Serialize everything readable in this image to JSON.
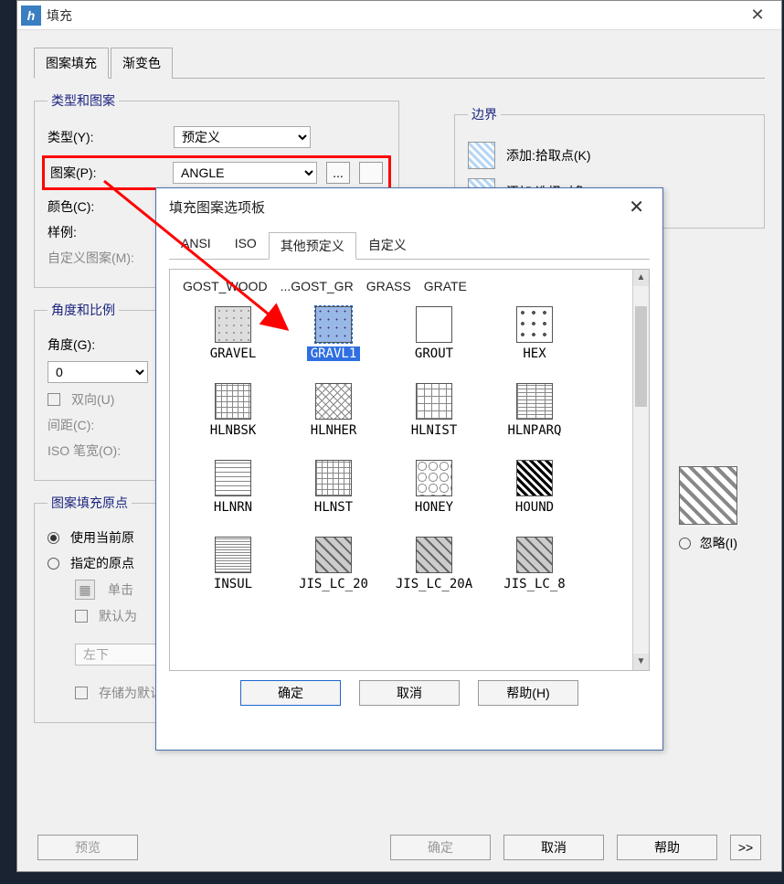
{
  "window": {
    "title": "填充"
  },
  "tabs": {
    "main": "图案填充",
    "gradient": "渐变色"
  },
  "group_type": {
    "legend": "类型和图案",
    "type_label": "类型(Y):",
    "type_value": "预定义",
    "pattern_label": "图案(P):",
    "pattern_value": "ANGLE",
    "browse": "...",
    "color_label": "颜色(C):",
    "sample_label": "样例:",
    "custom_label": "自定义图案(M):"
  },
  "group_angle": {
    "legend": "角度和比例",
    "angle_label": "角度(G):",
    "angle_value": "0",
    "two_dir": "双向(U)",
    "spacing_label": "间距(C):",
    "iso_label": "ISO 笔宽(O):"
  },
  "group_origin": {
    "legend": "图案填充原点",
    "use_current": "使用当前原",
    "specify": "指定的原点",
    "click": "单击",
    "default_as": "默认为",
    "leftbottom": "左下",
    "store": "存储为默认原点(F)"
  },
  "boundary": {
    "legend": "边界",
    "add_pick": "添加:拾取点(K)",
    "add_select": "添加:选择对象(B)",
    "ignore": "忽略(I)"
  },
  "footer": {
    "preview": "预览",
    "ok": "确定",
    "cancel": "取消",
    "help": "帮助",
    "expand": ">>"
  },
  "palette": {
    "title": "填充图案选项板",
    "tabs": {
      "ansi": "ANSI",
      "iso": "ISO",
      "other": "其他预定义",
      "custom": "自定义"
    },
    "toprow": [
      "GOST_WOOD",
      "...GOST_GR",
      "GRASS",
      "GRATE"
    ],
    "grid": [
      {
        "name": "GRAVEL",
        "cls": "p-gravel"
      },
      {
        "name": "GRAVL1",
        "cls": "p-gravl1",
        "selected": true
      },
      {
        "name": "GROUT",
        "cls": "p-grout"
      },
      {
        "name": "HEX",
        "cls": "p-hex"
      },
      {
        "name": "HLNBSK",
        "cls": "p-hlnbsk"
      },
      {
        "name": "HLNHER",
        "cls": "p-hlnher"
      },
      {
        "name": "HLNIST",
        "cls": "p-hlnist"
      },
      {
        "name": "HLNPARQ",
        "cls": "p-hlnparq"
      },
      {
        "name": "HLNRN",
        "cls": "p-hlnrn"
      },
      {
        "name": "HLNST",
        "cls": "p-hlnst"
      },
      {
        "name": "HONEY",
        "cls": "p-honey"
      },
      {
        "name": "HOUND",
        "cls": "p-hound"
      },
      {
        "name": "INSUL",
        "cls": "p-insul"
      },
      {
        "name": "JIS_LC_20",
        "cls": "p-jis"
      },
      {
        "name": "JIS_LC_20A",
        "cls": "p-jis"
      },
      {
        "name": "JIS_LC_8",
        "cls": "p-jis"
      }
    ],
    "ok": "确定",
    "cancel": "取消",
    "help": "帮助(H)"
  }
}
